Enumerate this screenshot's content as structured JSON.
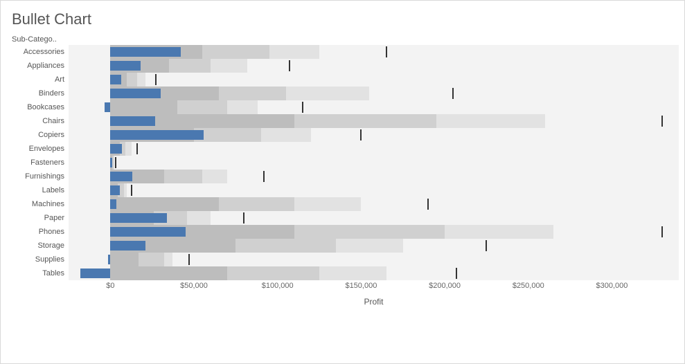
{
  "title": "Bullet Chart",
  "y_header": "Sub-Catego..",
  "x_title": "Profit",
  "chart_data": {
    "type": "bar",
    "subtype": "bullet",
    "xlabel": "Profit",
    "ylabel": "Sub-Category",
    "x_range": [
      -25000,
      340000
    ],
    "x_ticks": [
      0,
      50000,
      100000,
      150000,
      200000,
      250000,
      300000
    ],
    "x_tick_labels": [
      "$0",
      "$50,000",
      "$100,000",
      "$150,000",
      "$200,000",
      "$250,000",
      "$300,000"
    ],
    "series": [
      {
        "category": "Accessories",
        "value": 42000,
        "range_low": 55000,
        "range_mid": 95000,
        "range_high": 125000,
        "target": 165000
      },
      {
        "category": "Appliances",
        "value": 18000,
        "range_low": 35000,
        "range_mid": 60000,
        "range_high": 82000,
        "target": 107000
      },
      {
        "category": "Art",
        "value": 6500,
        "range_low": 10000,
        "range_mid": 16000,
        "range_high": 21000,
        "target": 27000
      },
      {
        "category": "Binders",
        "value": 30000,
        "range_low": 65000,
        "range_mid": 105000,
        "range_high": 155000,
        "target": 205000
      },
      {
        "category": "Bookcases",
        "value": -3500,
        "range_low": 40000,
        "range_mid": 70000,
        "range_high": 88000,
        "target": 115000
      },
      {
        "category": "Chairs",
        "value": 27000,
        "range_low": 110000,
        "range_mid": 195000,
        "range_high": 260000,
        "target": 330000
      },
      {
        "category": "Copiers",
        "value": 56000,
        "range_low": 50000,
        "range_mid": 90000,
        "range_high": 120000,
        "target": 150000
      },
      {
        "category": "Envelopes",
        "value": 7000,
        "range_low": 5500,
        "range_mid": 9000,
        "range_high": 12500,
        "target": 16000
      },
      {
        "category": "Fasteners",
        "value": 950,
        "range_low": 1000,
        "range_mid": 1800,
        "range_high": 2400,
        "target": 3000
      },
      {
        "category": "Furnishings",
        "value": 13000,
        "range_low": 32000,
        "range_mid": 55000,
        "range_high": 70000,
        "target": 92000
      },
      {
        "category": "Labels",
        "value": 5500,
        "range_low": 4500,
        "range_mid": 8000,
        "range_high": 10000,
        "target": 12500
      },
      {
        "category": "Machines",
        "value": 3400,
        "range_low": 65000,
        "range_mid": 110000,
        "range_high": 150000,
        "target": 190000
      },
      {
        "category": "Paper",
        "value": 34000,
        "range_low": 26000,
        "range_mid": 46000,
        "range_high": 60000,
        "target": 80000
      },
      {
        "category": "Phones",
        "value": 45000,
        "range_low": 110000,
        "range_mid": 200000,
        "range_high": 265000,
        "target": 330000
      },
      {
        "category": "Storage",
        "value": 21000,
        "range_low": 75000,
        "range_mid": 135000,
        "range_high": 175000,
        "target": 225000
      },
      {
        "category": "Supplies",
        "value": -1200,
        "range_low": 17000,
        "range_mid": 32000,
        "range_high": 37000,
        "target": 47000
      },
      {
        "category": "Tables",
        "value": -18000,
        "range_low": 70000,
        "range_mid": 125000,
        "range_high": 165000,
        "target": 207000
      }
    ]
  }
}
